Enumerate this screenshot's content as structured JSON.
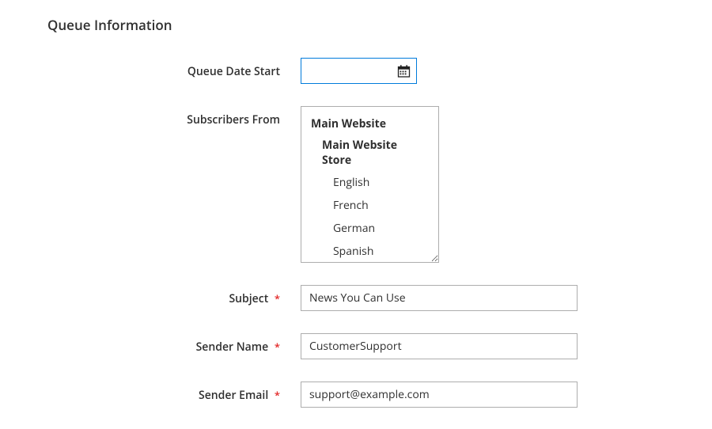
{
  "section": {
    "title": "Queue Information"
  },
  "fields": {
    "queue_date_start": {
      "label": "Queue Date Start",
      "value": ""
    },
    "subscribers_from": {
      "label": "Subscribers From",
      "website": "Main Website",
      "store": "Main Website Store",
      "options": [
        "English",
        "French",
        "German",
        "Spanish"
      ]
    },
    "subject": {
      "label": "Subject",
      "value": "News You Can Use"
    },
    "sender_name": {
      "label": "Sender Name",
      "value": "CustomerSupport"
    },
    "sender_email": {
      "label": "Sender Email",
      "value": "support@example.com"
    }
  },
  "required_marker": "*"
}
